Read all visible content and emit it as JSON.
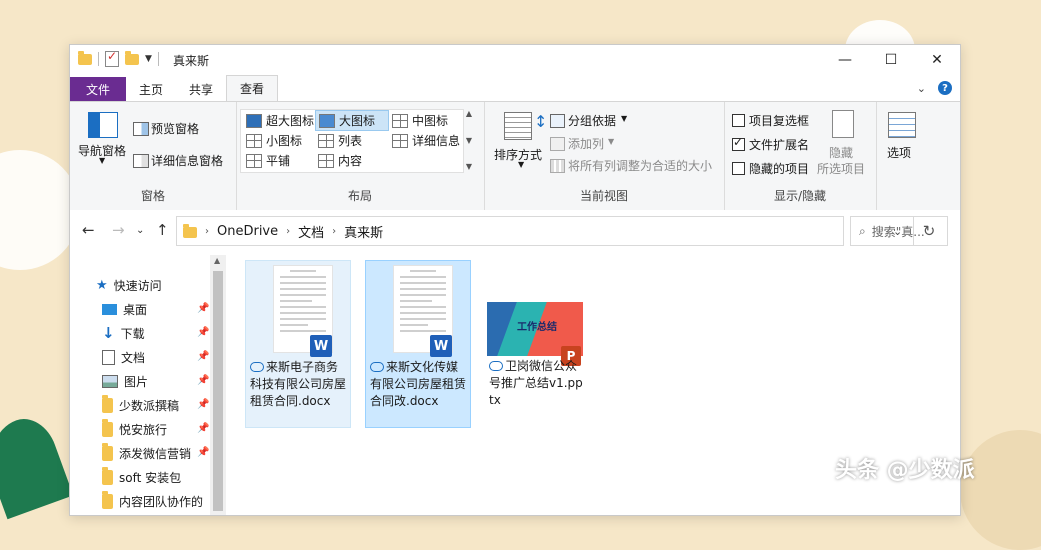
{
  "window": {
    "title": "真来斯"
  },
  "window_controls": {
    "minimize": "—",
    "maximize": "☐",
    "close": "✕"
  },
  "tabs": [
    {
      "label": "文件"
    },
    {
      "label": "主页"
    },
    {
      "label": "共享"
    },
    {
      "label": "查看"
    }
  ],
  "ribbon": {
    "panes": {
      "label": "窗格",
      "nav_pane": "导航窗格",
      "preview_pane": "预览窗格",
      "details_pane": "详细信息窗格"
    },
    "layout": {
      "label": "布局",
      "items": [
        {
          "label": "超大图标"
        },
        {
          "label": "大图标"
        },
        {
          "label": "中图标"
        },
        {
          "label": "小图标"
        },
        {
          "label": "列表"
        },
        {
          "label": "详细信息"
        },
        {
          "label": "平铺"
        },
        {
          "label": "内容"
        }
      ],
      "selected": "大图标"
    },
    "current_view": {
      "label": "当前视图",
      "sort": "排序方式",
      "group_by": "分组依据",
      "add_column": "添加列",
      "fit_columns": "将所有列调整为合适的大小"
    },
    "show_hide": {
      "label": "显示/隐藏",
      "item_checkboxes": {
        "label": "项目复选框",
        "checked": false
      },
      "file_extensions": {
        "label": "文件扩展名",
        "checked": true
      },
      "hidden_items": {
        "label": "隐藏的项目",
        "checked": false
      },
      "hide": "隐藏",
      "hide_selected": "所选项目"
    },
    "options": {
      "label": "选项"
    }
  },
  "address": {
    "crumbs": [
      "OneDrive",
      "文档",
      "真来斯"
    ],
    "search_placeholder": "搜索\"真..."
  },
  "nav": {
    "quick_access": "快速访问",
    "items": [
      {
        "label": "桌面",
        "icon": "desktop-icon"
      },
      {
        "label": "下载",
        "icon": "download-icon"
      },
      {
        "label": "文档",
        "icon": "document-icon"
      },
      {
        "label": "图片",
        "icon": "pictures-icon"
      },
      {
        "label": "少数派撰稿",
        "icon": "folder-icon"
      },
      {
        "label": "悦安旅行",
        "icon": "folder-icon"
      },
      {
        "label": "添发微信营销",
        "icon": "folder-icon"
      },
      {
        "label": "soft 安装包",
        "icon": "folder-icon"
      },
      {
        "label": "内容团队协作的",
        "icon": "folder-icon"
      }
    ]
  },
  "files": [
    {
      "name": "来斯电子商务科技有限公司房屋租赁合同.docx",
      "type": "word"
    },
    {
      "name": "来斯文化传媒有限公司房屋租赁合同改.docx",
      "type": "word"
    },
    {
      "name": "卫岗微信公众号推广总结v1.pptx",
      "type": "ppt",
      "thumb_title": "工作总结"
    }
  ],
  "watermark": "头条 @少数派",
  "colors": {
    "file_tab": "#6a2c91",
    "selection": "#cce8ff",
    "accent": "#1b6ec2"
  }
}
